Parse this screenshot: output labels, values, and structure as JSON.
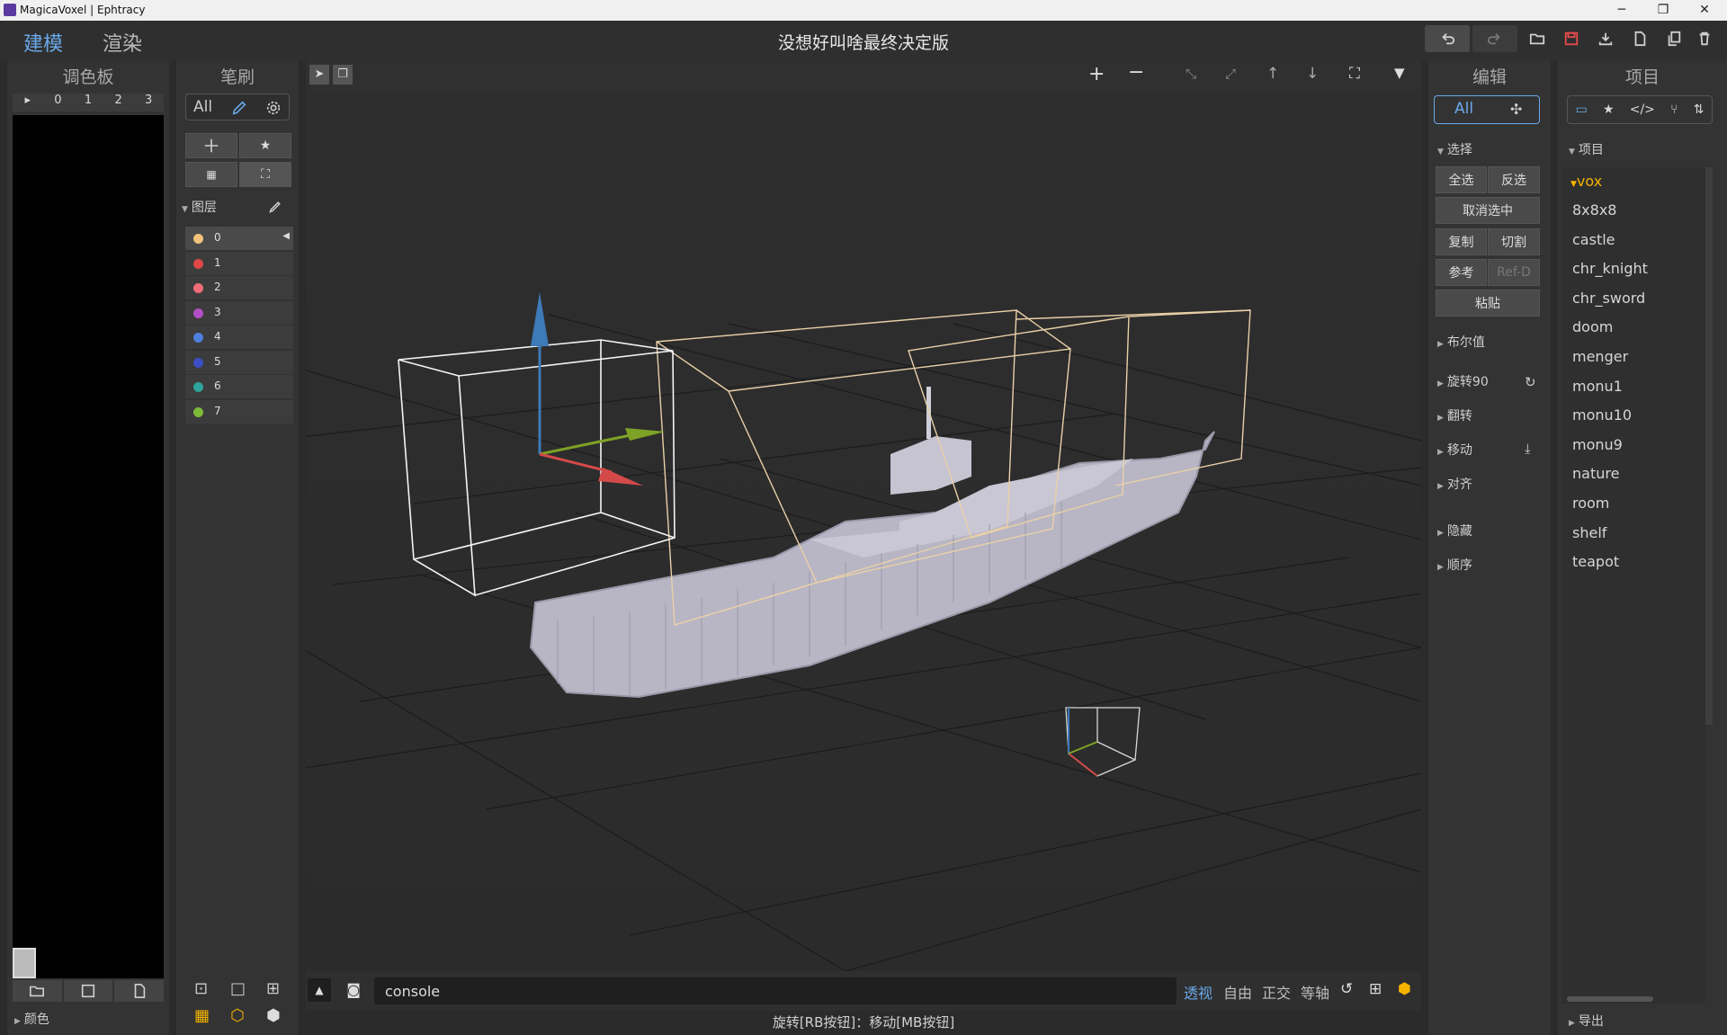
{
  "window": {
    "title": "MagicaVoxel | Ephtracy",
    "minimize": "─",
    "restore": "❐",
    "close": "✕"
  },
  "menu": {
    "model_tab": "建模",
    "render_tab": "渲染",
    "doc_title": "没想好叫啥最终决定版"
  },
  "palette": {
    "title": "调色板",
    "tabs": [
      "▸",
      "0",
      "1",
      "2",
      "3"
    ],
    "footer": "颜色"
  },
  "brush": {
    "title": "笔刷",
    "all": "All"
  },
  "layers": {
    "title": "图层",
    "items": [
      {
        "label": "0",
        "color": "#f2c27a"
      },
      {
        "label": "1",
        "color": "#e04848"
      },
      {
        "label": "2",
        "color": "#ef6d78"
      },
      {
        "label": "3",
        "color": "#b34fc6"
      },
      {
        "label": "4",
        "color": "#4f7fdc"
      },
      {
        "label": "5",
        "color": "#3c4fc4"
      },
      {
        "label": "6",
        "color": "#2ea39a"
      },
      {
        "label": "7",
        "color": "#7dba3a"
      }
    ]
  },
  "edit": {
    "title": "编辑",
    "all": "All",
    "select_section": "选择",
    "select_all": "全选",
    "invert": "反选",
    "deselect": "取消选中",
    "copy": "复制",
    "cut": "切割",
    "ref": "参考",
    "ref_d": "Ref-D",
    "paste": "粘贴",
    "sections": [
      "布尔值",
      "旋转90",
      "翻转",
      "移动",
      "对齐",
      "隐藏",
      "顺序"
    ]
  },
  "project": {
    "title": "项目",
    "section": "项目",
    "folder": "vox",
    "items": [
      "8x8x8",
      "castle",
      "chr_knight",
      "chr_sword",
      "doom",
      "menger",
      "monu1",
      "monu10",
      "monu9",
      "nature",
      "room",
      "shelf",
      "teapot"
    ],
    "footer": "导出"
  },
  "bottom": {
    "console": "console",
    "modes": [
      "透视",
      "自由",
      "正交",
      "等轴"
    ],
    "status": "旋转[RB按钮]：移动[MB按钮]"
  },
  "colors": {
    "accent": "#6aa8e8",
    "save": "#e84a4a",
    "folder": "#f4b400"
  }
}
